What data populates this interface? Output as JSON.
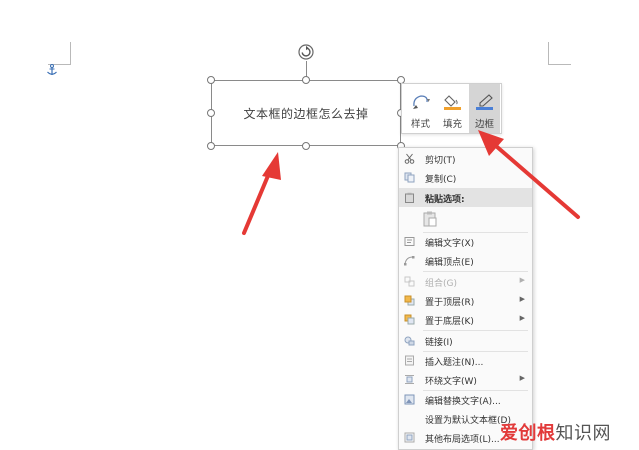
{
  "textbox": {
    "text": "文本框的边框怎么去掉"
  },
  "mini_toolbar": {
    "buttons": [
      {
        "label": "样式",
        "icon": "shape-style-icon"
      },
      {
        "label": "填充",
        "icon": "fill-bucket-icon",
        "accent": "#f0a02c"
      },
      {
        "label": "边框",
        "icon": "outline-pen-icon",
        "accent": "#4a7fd6",
        "active": true
      }
    ]
  },
  "context_menu": {
    "cut": "剪切(T)",
    "copy": "复制(C)",
    "paste_options": "粘贴选项:",
    "edit_text": "编辑文字(X)",
    "edit_points": "编辑顶点(E)",
    "group": "组合(G)",
    "bring_to_front": "置于顶层(R)",
    "send_to_back": "置于底层(K)",
    "link": "链接(I)",
    "insert_caption": "插入题注(N)...",
    "wrap_text": "环绕文字(W)",
    "edit_alt_text": "编辑替换文字(A)...",
    "set_default": "设置为默认文本框(D)",
    "more_layout": "其他布局选项(L)..."
  },
  "watermark": {
    "brand": "爱创根",
    "site": "知识网"
  },
  "colors": {
    "arrow": "#e53935",
    "selection_border": "#8a8a8a",
    "menu_header_bg": "#e3e3e3"
  }
}
